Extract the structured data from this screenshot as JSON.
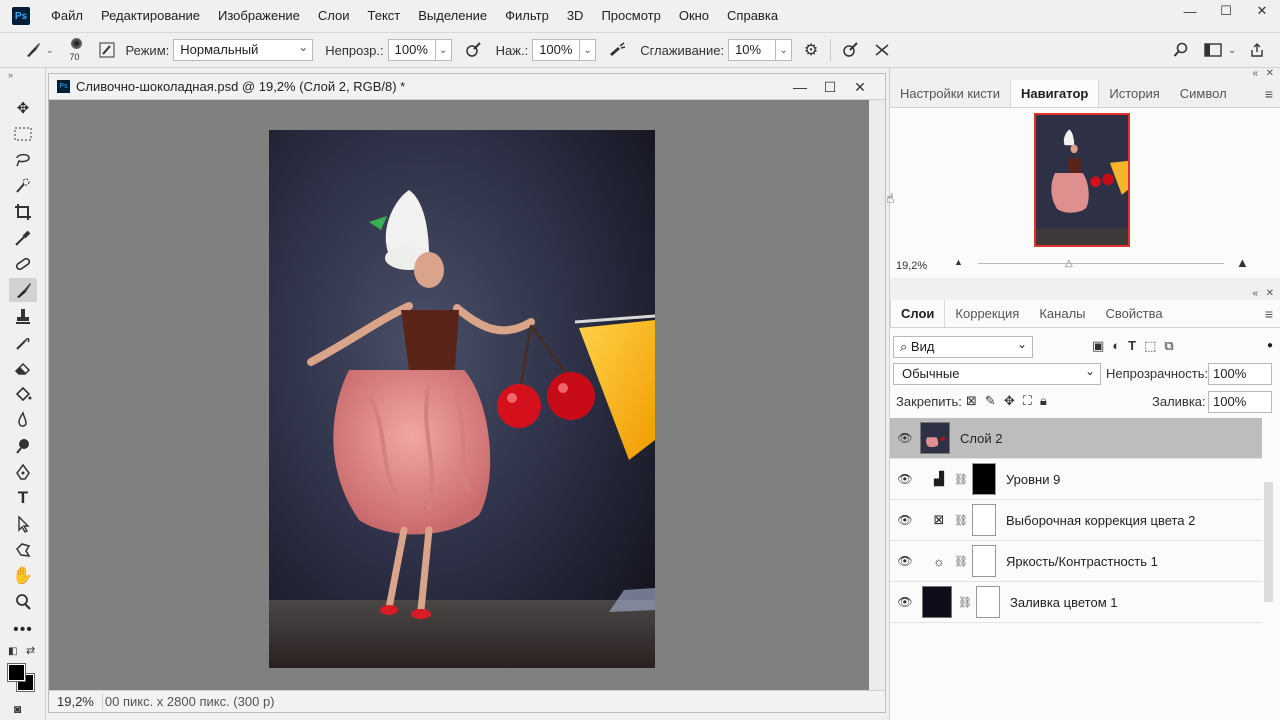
{
  "app": {
    "logo": "Ps"
  },
  "menu": [
    "Файл",
    "Редактирование",
    "Изображение",
    "Слои",
    "Текст",
    "Выделение",
    "Фильтр",
    "3D",
    "Просмотр",
    "Окно",
    "Справка"
  ],
  "window_controls": {
    "minimize": "—",
    "maximize": "☐",
    "close": "✕"
  },
  "options_bar": {
    "brush_size": "70",
    "mode_label": "Режим:",
    "mode_value": "Нормальный",
    "opacity_label": "Непрозр.:",
    "opacity_value": "100%",
    "pressure_label": "Наж.:",
    "pressure_value": "100%",
    "smoothing_label": "Сглаживание:",
    "smoothing_value": "10%"
  },
  "document": {
    "title": "Сливочно-шоколадная.psd @ 19,2% (Слой 2, RGB/8) *",
    "zoom": "19,2%",
    "info": "00 пикс. x 2800 пикс. (300 р)"
  },
  "top_panel": {
    "tabs": [
      "Настройки кисти",
      "Навигатор",
      "История",
      "Символ"
    ],
    "active_tab": "Навигатор",
    "zoom": "19,2%"
  },
  "layers_panel": {
    "tabs": [
      "Слои",
      "Коррекция",
      "Каналы",
      "Свойства"
    ],
    "active_tab": "Слои",
    "kind_filter": "Вид",
    "blend_mode": "Обычные",
    "opacity_label": "Непрозрачность:",
    "opacity_value": "100%",
    "lock_label": "Закрепить:",
    "fill_label": "Заливка:",
    "fill_value": "100%",
    "layers": [
      {
        "name": "Слой 2",
        "selected": true
      },
      {
        "name": "Уровни 9",
        "selected": false
      },
      {
        "name": "Выборочная коррекция цвета 2",
        "selected": false
      },
      {
        "name": "Яркость/Контрастность 1",
        "selected": false
      },
      {
        "name": "Заливка цветом 1",
        "selected": false
      }
    ]
  },
  "colors": {
    "accent_red": "#e03030",
    "selected_layer": "#bdbdbd",
    "canvas_bg": "#808080"
  }
}
